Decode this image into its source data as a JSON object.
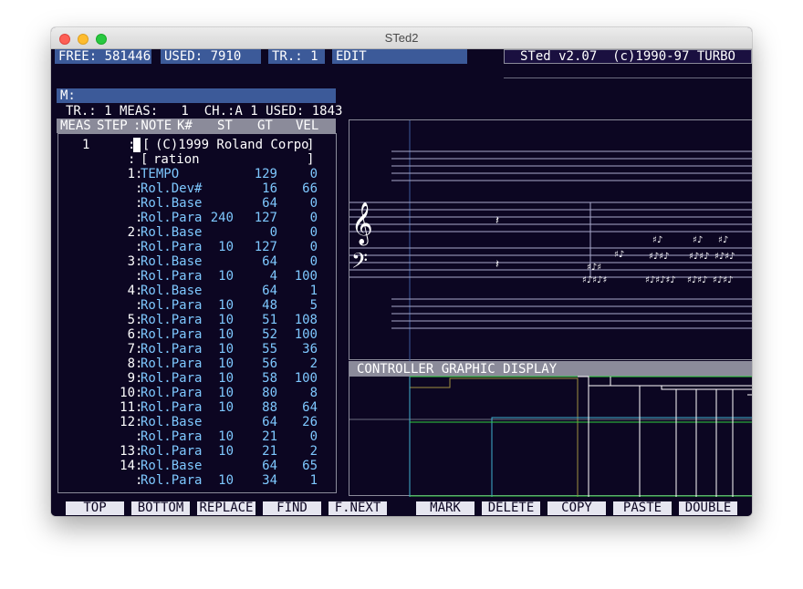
{
  "window": {
    "title": "STed2"
  },
  "status": {
    "free": "FREE: 581446",
    "used": "USED:    7910",
    "track": "TR.: 1",
    "mode": "EDIT",
    "version": "STed v2.07  (c)1990-97 TURBO"
  },
  "cmd_line": "M:",
  "info_line": "TR.: 1 MEAS:   1  CH.:A 1 USED: 1843",
  "headers": {
    "meas": "MEAS",
    "step": "STEP",
    "note": ":NOTE",
    "kn": "K#",
    "st": "ST",
    "gt": "GT",
    "vel": "VEL"
  },
  "comment": {
    "meas": "1",
    "line1": "(C)1999 Roland Corpo",
    "line2": "ration"
  },
  "rows": [
    {
      "step": "1",
      "note": "TEMPO",
      "kn": "",
      "st": "129",
      "gt": "0",
      "vel": ""
    },
    {
      "step": "",
      "note": "Rol.Dev#",
      "kn": "",
      "st": "16",
      "gt": "66",
      "vel": ""
    },
    {
      "step": "",
      "note": "Rol.Base",
      "kn": "",
      "st": "64",
      "gt": "0",
      "vel": ""
    },
    {
      "step": "",
      "note": "Rol.Para",
      "kn": "240",
      "st": "127",
      "gt": "0",
      "vel": ""
    },
    {
      "step": "2",
      "note": "Rol.Base",
      "kn": "",
      "st": "0",
      "gt": "0",
      "vel": ""
    },
    {
      "step": "",
      "note": "Rol.Para",
      "kn": "10",
      "st": "127",
      "gt": "0",
      "vel": ""
    },
    {
      "step": "3",
      "note": "Rol.Base",
      "kn": "",
      "st": "64",
      "gt": "0",
      "vel": ""
    },
    {
      "step": "",
      "note": "Rol.Para",
      "kn": "10",
      "st": "4",
      "gt": "100",
      "vel": ""
    },
    {
      "step": "4",
      "note": "Rol.Base",
      "kn": "",
      "st": "64",
      "gt": "1",
      "vel": ""
    },
    {
      "step": "",
      "note": "Rol.Para",
      "kn": "10",
      "st": "48",
      "gt": "5",
      "vel": ""
    },
    {
      "step": "5",
      "note": "Rol.Para",
      "kn": "10",
      "st": "51",
      "gt": "108",
      "vel": ""
    },
    {
      "step": "6",
      "note": "Rol.Para",
      "kn": "10",
      "st": "52",
      "gt": "100",
      "vel": ""
    },
    {
      "step": "7",
      "note": "Rol.Para",
      "kn": "10",
      "st": "55",
      "gt": "36",
      "vel": ""
    },
    {
      "step": "8",
      "note": "Rol.Para",
      "kn": "10",
      "st": "56",
      "gt": "2",
      "vel": ""
    },
    {
      "step": "9",
      "note": "Rol.Para",
      "kn": "10",
      "st": "58",
      "gt": "100",
      "vel": ""
    },
    {
      "step": "10",
      "note": "Rol.Para",
      "kn": "10",
      "st": "80",
      "gt": "8",
      "vel": ""
    },
    {
      "step": "11",
      "note": "Rol.Para",
      "kn": "10",
      "st": "88",
      "gt": "64",
      "vel": ""
    },
    {
      "step": "12",
      "note": "Rol.Base",
      "kn": "",
      "st": "64",
      "gt": "26",
      "vel": ""
    },
    {
      "step": "",
      "note": "Rol.Para",
      "kn": "10",
      "st": "21",
      "gt": "0",
      "vel": ""
    },
    {
      "step": "13",
      "note": "Rol.Para",
      "kn": "10",
      "st": "21",
      "gt": "2",
      "vel": ""
    },
    {
      "step": "14",
      "note": "Rol.Base",
      "kn": "",
      "st": "64",
      "gt": "65",
      "vel": ""
    },
    {
      "step": "",
      "note": "Rol.Para",
      "kn": "10",
      "st": "34",
      "gt": "1",
      "vel": ""
    }
  ],
  "controller_title": "CONTROLLER GRAPHIC DISPLAY",
  "function_keys": [
    "TOP",
    "BOTTOM",
    "REPLACE",
    "FIND",
    "F.NEXT",
    "MARK",
    "DELETE",
    "COPY",
    "PASTE",
    "DOUBLE"
  ],
  "colors": {
    "background": "#0c0622",
    "status_bar": "#3c5a99",
    "header_bar": "#8b8b9a",
    "event_text": "#7ec8ff",
    "ctrl_olive": "#a09040",
    "ctrl_cyan": "#40b0d0",
    "ctrl_green": "#30d040"
  },
  "icons": [
    "close-light",
    "minimize-light",
    "zoom-light",
    "treble-clef-icon",
    "bass-clef-icon",
    "rest-icon"
  ]
}
